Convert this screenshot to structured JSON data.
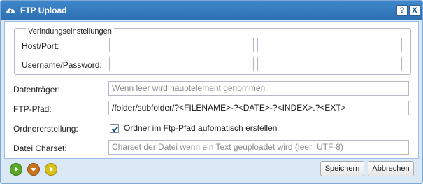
{
  "window": {
    "title": "FTP Upload",
    "help_glyph": "?",
    "close_glyph": "X"
  },
  "connection": {
    "legend": "Verindungseinstellungen",
    "host_port_label": "Host/Port:",
    "host_value": "",
    "port_value": "",
    "user_pass_label": "Username/Password:",
    "username_value": "",
    "password_value": ""
  },
  "form": {
    "datentraeger_label": "Datenträger:",
    "datentraeger_placeholder": "Wenn leer wird hauptelement genommen",
    "ftp_pfad_label": "FTP-Pfad:",
    "ftp_pfad_value": "/folder/subfolder/?<FILENAME>-?<DATE>-?<INDEX>.?<EXT>",
    "ordner_label": "Ordnererstellung:",
    "ordner_checkbox_label": "Ordner im Ftp-Pfad aufomatisch erstellen",
    "ordner_checked": true,
    "charset_label": "Datei Charset:",
    "charset_placeholder": "Charset der Datei wenn ein Text geuploadet wird (leer=UTF-8)"
  },
  "footer": {
    "save_label": "Speichern",
    "cancel_label": "Abbrechen",
    "icons": [
      "play-green-icon",
      "arrow-down-orange-icon",
      "play-yellow-icon"
    ]
  },
  "colors": {
    "titlebar": "#2f78bf",
    "window_bg": "#dbe8f6",
    "green": "#5aa82a",
    "orange": "#c8741e",
    "yellow": "#d8c11a"
  }
}
